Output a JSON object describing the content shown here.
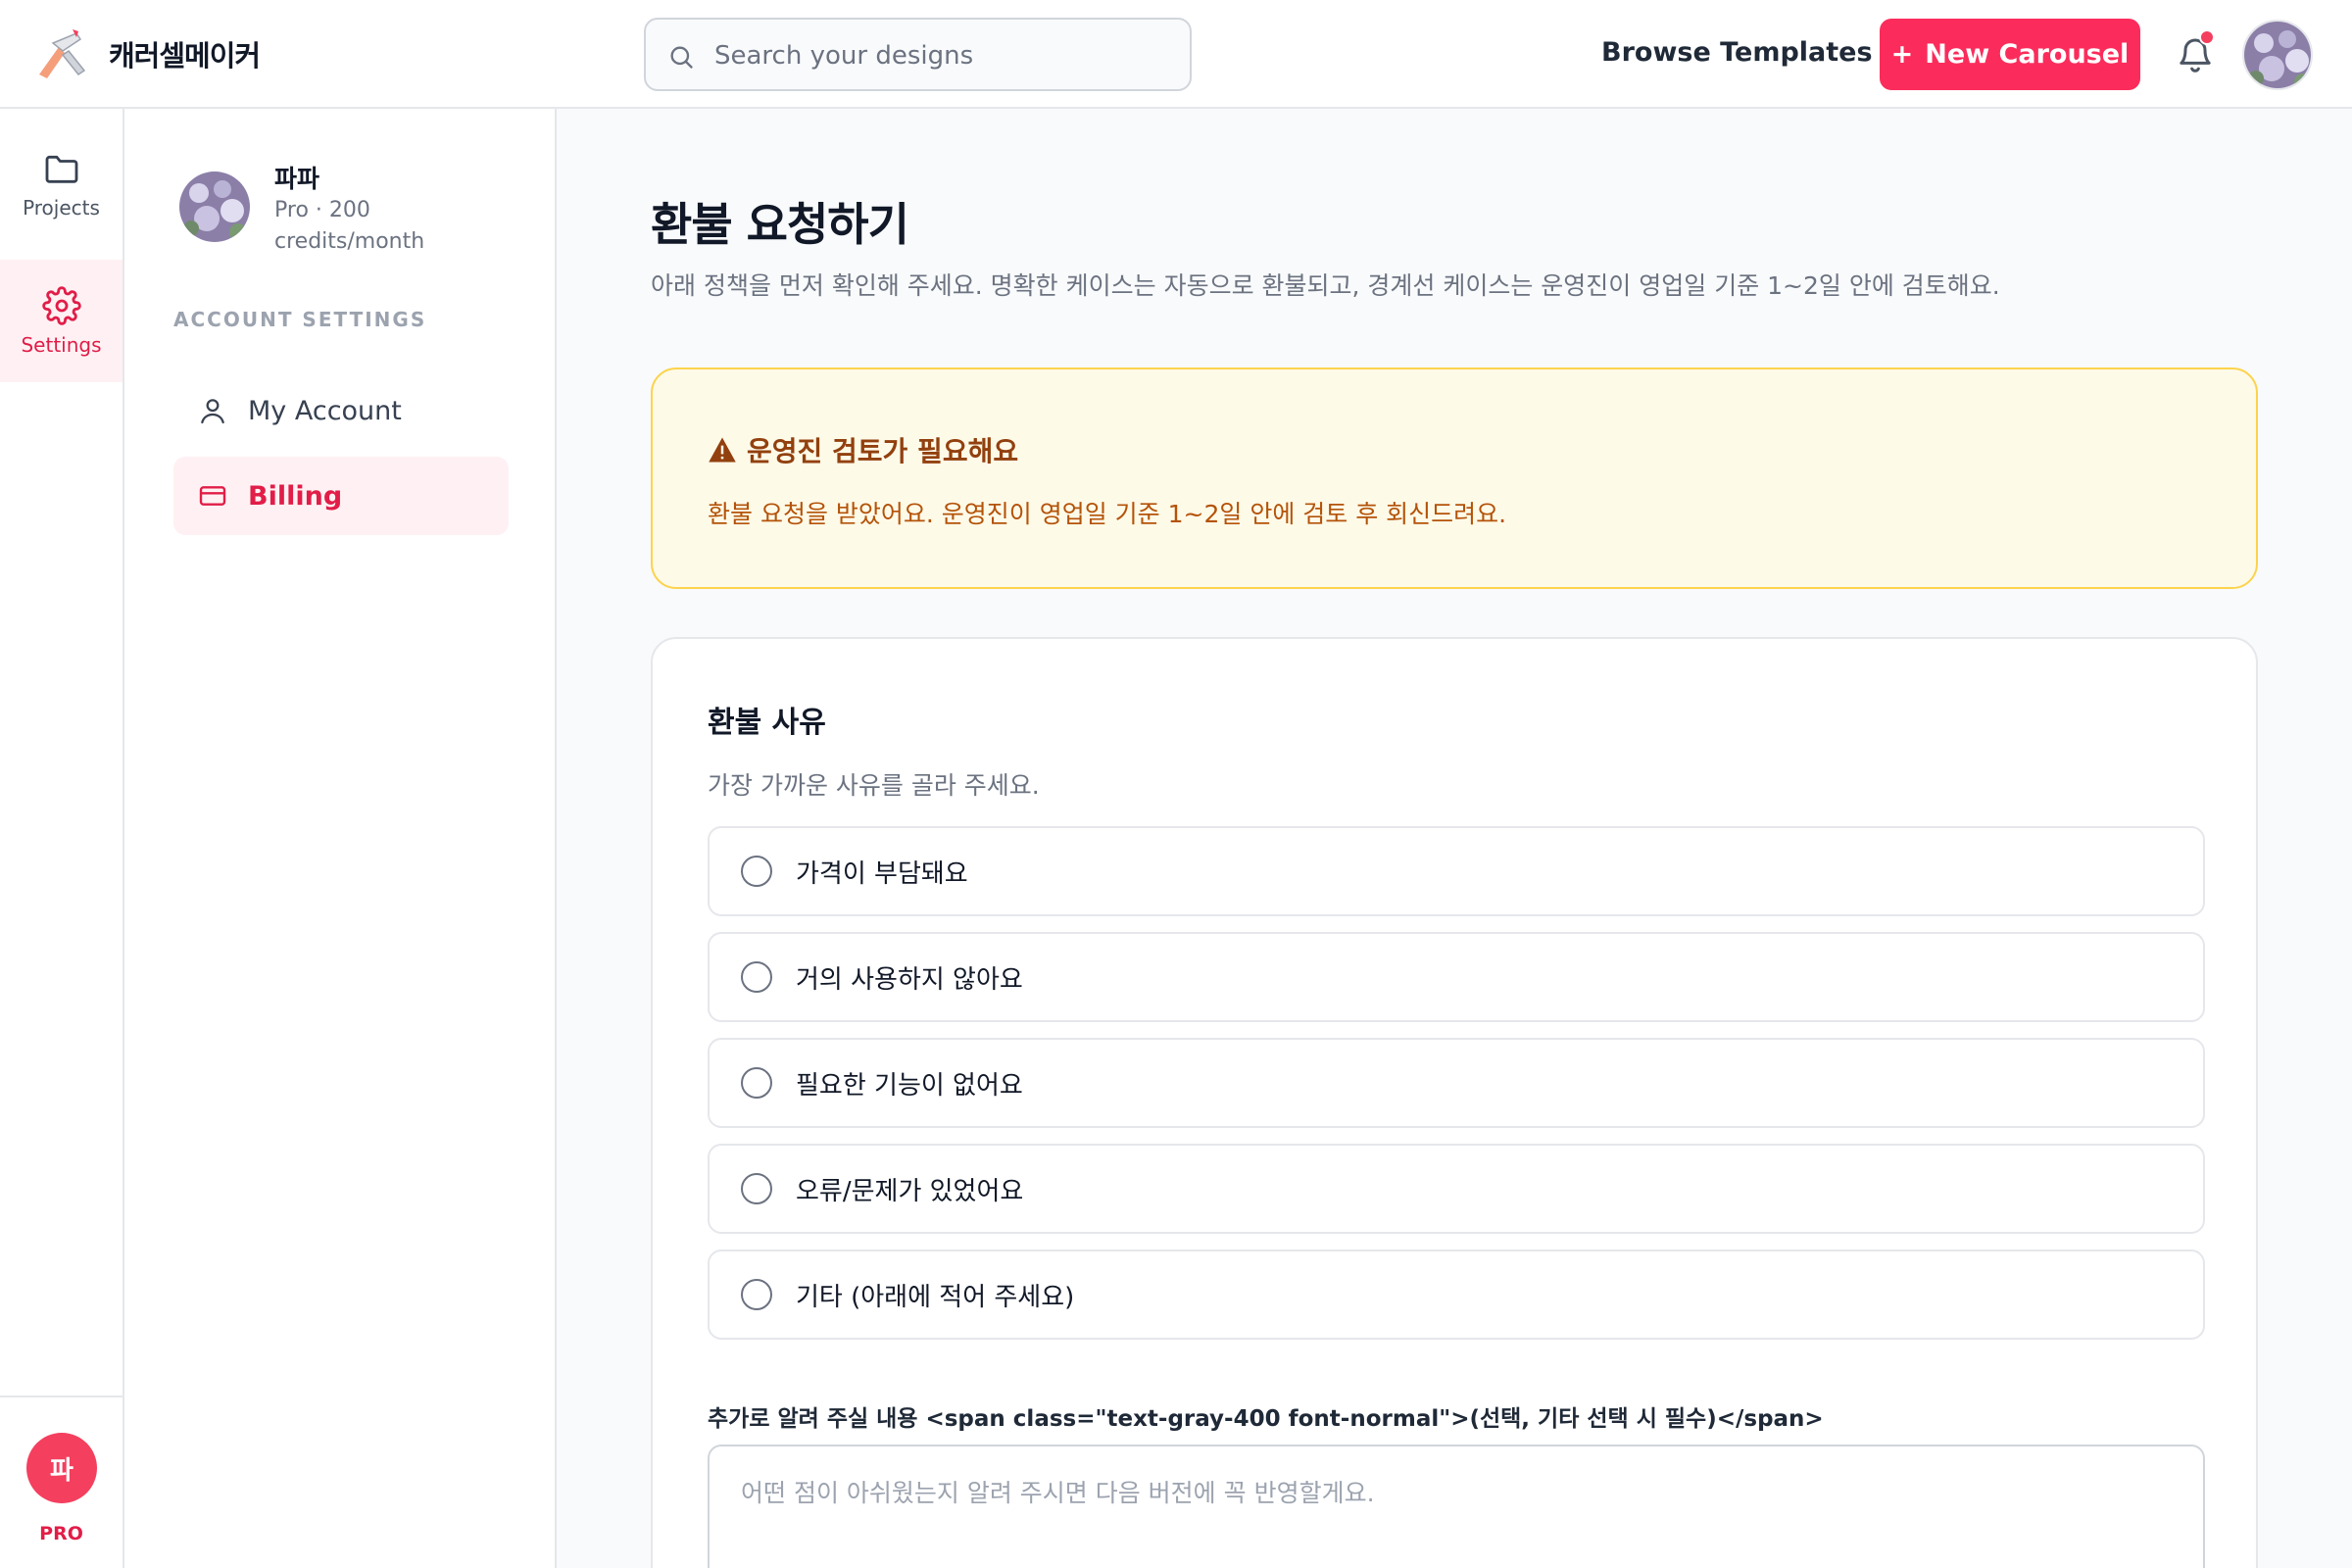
{
  "header": {
    "brand": "캐러셀메이커",
    "search_placeholder": "Search your designs",
    "browse_label": "Browse Templates",
    "new_button_label": "New Carousel",
    "new_button_plus": "+"
  },
  "rail": {
    "items": [
      {
        "label": "Projects",
        "icon": "folder-icon"
      },
      {
        "label": "Settings",
        "icon": "gear-icon"
      }
    ],
    "avatar_initial": "파",
    "plan_badge": "PRO"
  },
  "sidebar": {
    "user_name": "파파",
    "user_plan": "Pro · 200 credits/month",
    "section_label": "ACCOUNT SETTINGS",
    "items": [
      {
        "label": "My Account",
        "icon": "user-icon"
      },
      {
        "label": "Billing",
        "icon": "credit-card-icon"
      }
    ]
  },
  "main": {
    "title": "환불 요청하기",
    "subtitle": "아래 정책을 먼저 확인해 주세요. 명확한 케이스는 자동으로 환불되고, 경계선 케이스는 운영진이 영업일 기준 1~2일 안에 검토해요.",
    "notice": {
      "title": "운영진 검토가 필요해요",
      "text": "환불 요청을 받았어요. 운영진이 영업일 기준 1~2일 안에 검토 후 회신드려요."
    },
    "reason_card": {
      "title": "환불 사유",
      "subtitle": "가장 가까운 사유를 골라 주세요.",
      "options": [
        "가격이 부담돼요",
        "거의 사용하지 않아요",
        "필요한 기능이 없어요",
        "오류/문제가 있었어요",
        "기타 (아래에 적어 주세요)"
      ],
      "extra_label": "추가로 알려 주실 내용 <span class=\"text-gray-400 font-normal\">(선택, 기타 선택 시 필수)</span>",
      "extra_placeholder": "어떤 점이 아쉬웠는지 알려 주시면 다음 버전에 꼭 반영할게요."
    }
  }
}
